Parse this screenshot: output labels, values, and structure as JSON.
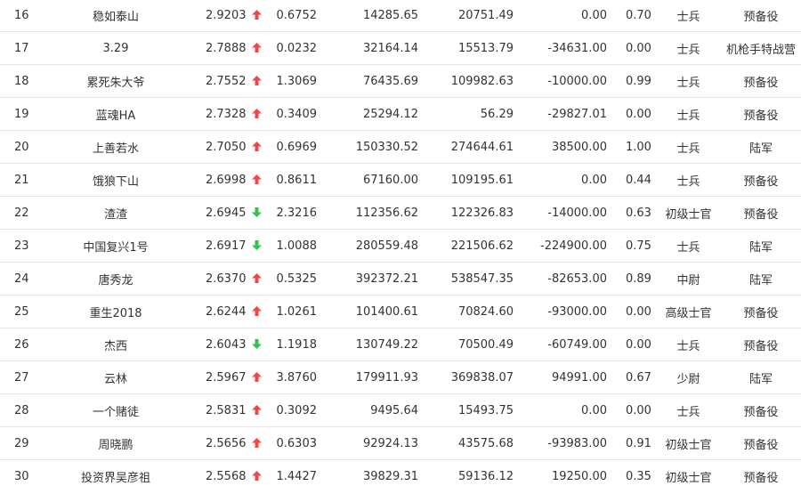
{
  "rows": [
    {
      "rank": "16",
      "name": "稳如泰山",
      "value": "2.9203",
      "trend": "up",
      "c4": "0.6752",
      "c5": "14285.65",
      "c6": "20751.49",
      "c7": "0.00",
      "c8": "0.70",
      "title": "士兵",
      "group": "预备役"
    },
    {
      "rank": "17",
      "name": "3.29",
      "value": "2.7888",
      "trend": "up",
      "c4": "0.0232",
      "c5": "32164.14",
      "c6": "15513.79",
      "c7": "-34631.00",
      "c8": "0.00",
      "title": "士兵",
      "group": "机枪手特战营"
    },
    {
      "rank": "18",
      "name": "累死朱大爷",
      "value": "2.7552",
      "trend": "up",
      "c4": "1.3069",
      "c5": "76435.69",
      "c6": "109982.63",
      "c7": "-10000.00",
      "c8": "0.99",
      "title": "士兵",
      "group": "预备役"
    },
    {
      "rank": "19",
      "name": "蓝魂HA",
      "value": "2.7328",
      "trend": "up",
      "c4": "0.3409",
      "c5": "25294.12",
      "c6": "56.29",
      "c7": "-29827.01",
      "c8": "0.00",
      "title": "士兵",
      "group": "预备役"
    },
    {
      "rank": "20",
      "name": "上善若水",
      "value": "2.7050",
      "trend": "up",
      "c4": "0.6969",
      "c5": "150330.52",
      "c6": "274644.61",
      "c7": "38500.00",
      "c8": "1.00",
      "title": "士兵",
      "group": "陆军"
    },
    {
      "rank": "21",
      "name": "饿狼下山",
      "value": "2.6998",
      "trend": "up",
      "c4": "0.8611",
      "c5": "67160.00",
      "c6": "109195.61",
      "c7": "0.00",
      "c8": "0.44",
      "title": "士兵",
      "group": "预备役"
    },
    {
      "rank": "22",
      "name": "渣渣",
      "value": "2.6945",
      "trend": "down",
      "c4": "2.3216",
      "c5": "112356.62",
      "c6": "122326.83",
      "c7": "-14000.00",
      "c8": "0.63",
      "title": "初级士官",
      "group": "预备役"
    },
    {
      "rank": "23",
      "name": "中国复兴1号",
      "value": "2.6917",
      "trend": "down",
      "c4": "1.0088",
      "c5": "280559.48",
      "c6": "221506.62",
      "c7": "-224900.00",
      "c8": "0.75",
      "title": "士兵",
      "group": "陆军"
    },
    {
      "rank": "24",
      "name": "唐秀龙",
      "value": "2.6370",
      "trend": "up",
      "c4": "0.5325",
      "c5": "392372.21",
      "c6": "538547.35",
      "c7": "-82653.00",
      "c8": "0.89",
      "title": "中尉",
      "group": "陆军"
    },
    {
      "rank": "25",
      "name": "重生2018",
      "value": "2.6244",
      "trend": "up",
      "c4": "1.0261",
      "c5": "101400.61",
      "c6": "70824.60",
      "c7": "-93000.00",
      "c8": "0.00",
      "title": "高级士官",
      "group": "预备役"
    },
    {
      "rank": "26",
      "name": "杰西",
      "value": "2.6043",
      "trend": "down",
      "c4": "1.1918",
      "c5": "130749.22",
      "c6": "70500.49",
      "c7": "-60749.00",
      "c8": "0.00",
      "title": "士兵",
      "group": "预备役"
    },
    {
      "rank": "27",
      "name": "云林",
      "value": "2.5967",
      "trend": "up",
      "c4": "3.8760",
      "c5": "179911.93",
      "c6": "369838.07",
      "c7": "94991.00",
      "c8": "0.67",
      "title": "少尉",
      "group": "陆军"
    },
    {
      "rank": "28",
      "name": "一个赌徒",
      "value": "2.5831",
      "trend": "up",
      "c4": "0.3092",
      "c5": "9495.64",
      "c6": "15493.75",
      "c7": "0.00",
      "c8": "0.00",
      "title": "士兵",
      "group": "预备役"
    },
    {
      "rank": "29",
      "name": "周晓鹏",
      "value": "2.5656",
      "trend": "up",
      "c4": "0.6303",
      "c5": "92924.13",
      "c6": "43575.68",
      "c7": "-93983.00",
      "c8": "0.91",
      "title": "初级士官",
      "group": "预备役"
    },
    {
      "rank": "30",
      "name": "投资界吴彦祖",
      "value": "2.5568",
      "trend": "up",
      "c4": "1.4427",
      "c5": "39829.31",
      "c6": "59136.12",
      "c7": "19250.00",
      "c8": "0.35",
      "title": "初级士官",
      "group": "预备役"
    }
  ],
  "trend_icons": {
    "up": "arrow-up-icon",
    "down": "arrow-down-icon"
  },
  "colors": {
    "up": "#f04848",
    "down": "#2ec64a",
    "row_border": "#e6e6e6",
    "text": "#333333"
  }
}
